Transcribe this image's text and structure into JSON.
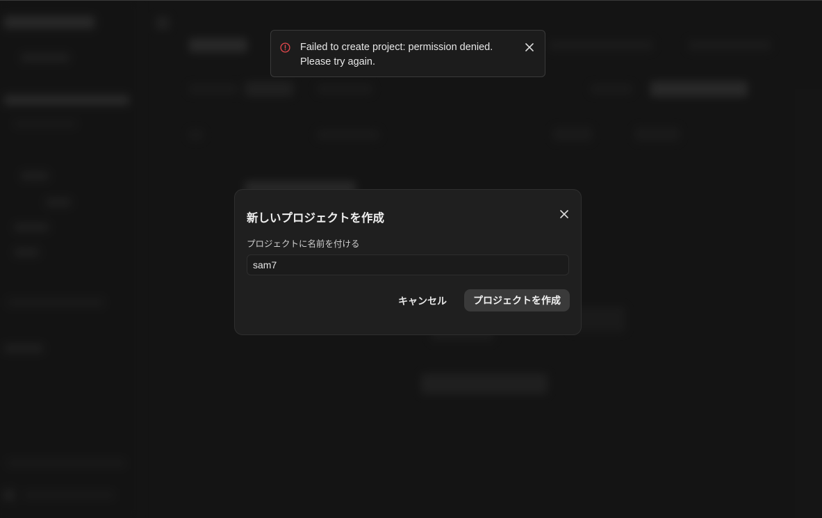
{
  "toast": {
    "message": "Failed to create project: permission denied.\nPlease try again.",
    "icon": "alert-circle-icon",
    "icon_color": "#e5484d"
  },
  "modal": {
    "title": "新しいプロジェクトを作成",
    "name_label": "プロジェクトに名前を付ける",
    "name_value": "sam7",
    "cancel_label": "キャンセル",
    "create_label": "プロジェクトを作成"
  },
  "colors": {
    "background": "#1b1b1b",
    "modal_background": "#1f1f1f",
    "primary_button": "#3a3a3a"
  }
}
